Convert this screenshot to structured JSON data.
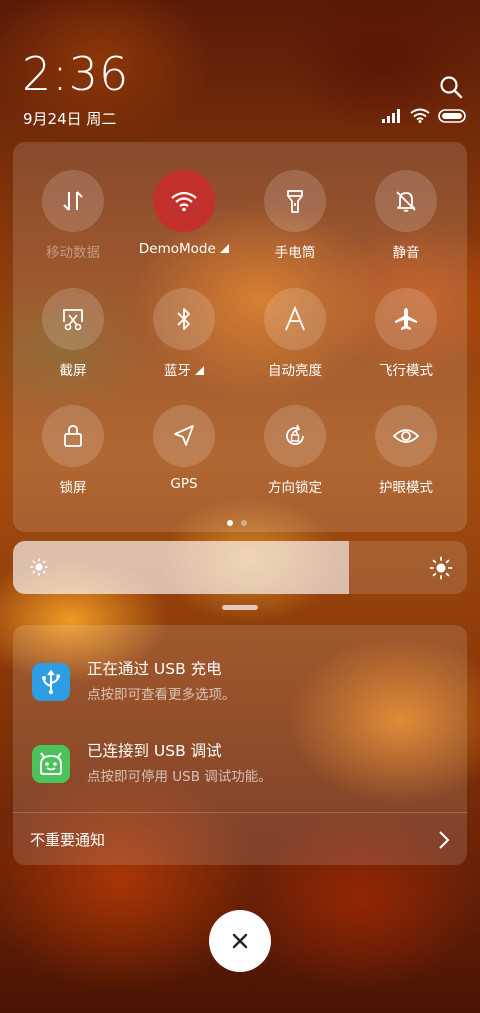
{
  "status": {
    "time": "2:36",
    "date": "9月24日 周二"
  },
  "tiles": [
    {
      "label": "移动数据",
      "icon": "mobile-data-icon",
      "active": false,
      "dim": true
    },
    {
      "label": "DemoMode",
      "icon": "wifi-icon",
      "active": true,
      "dim": false
    },
    {
      "label": "手电筒",
      "icon": "flashlight-icon",
      "active": false,
      "dim": false
    },
    {
      "label": "静音",
      "icon": "mute-bell-icon",
      "active": false,
      "dim": false
    },
    {
      "label": "截屏",
      "icon": "screenshot-icon",
      "active": false,
      "dim": false
    },
    {
      "label": "蓝牙",
      "icon": "bluetooth-icon",
      "active": false,
      "dim": false
    },
    {
      "label": "自动亮度",
      "icon": "auto-brightness-icon",
      "active": false,
      "dim": false
    },
    {
      "label": "飞行模式",
      "icon": "airplane-icon",
      "active": false,
      "dim": false
    },
    {
      "label": "锁屏",
      "icon": "lock-icon",
      "active": false,
      "dim": false
    },
    {
      "label": "GPS",
      "icon": "gps-icon",
      "active": false,
      "dim": false
    },
    {
      "label": "方向锁定",
      "icon": "rotation-lock-icon",
      "active": false,
      "dim": false
    },
    {
      "label": "护眼模式",
      "icon": "eye-icon",
      "active": false,
      "dim": false
    }
  ],
  "brightness": {
    "level": 0.74
  },
  "notifications": [
    {
      "title": "正在通过 USB 充电",
      "subtitle": "点按即可查看更多选项。",
      "icon": "usb-icon",
      "color": "#2f9de4"
    },
    {
      "title": "已连接到 USB 调试",
      "subtitle": "点按即可停用 USB 调试功能。",
      "icon": "android-icon",
      "color": "#4cc35a"
    }
  ],
  "unimportant_label": "不重要通知",
  "colors": {
    "active_tile": "#c4302c"
  }
}
